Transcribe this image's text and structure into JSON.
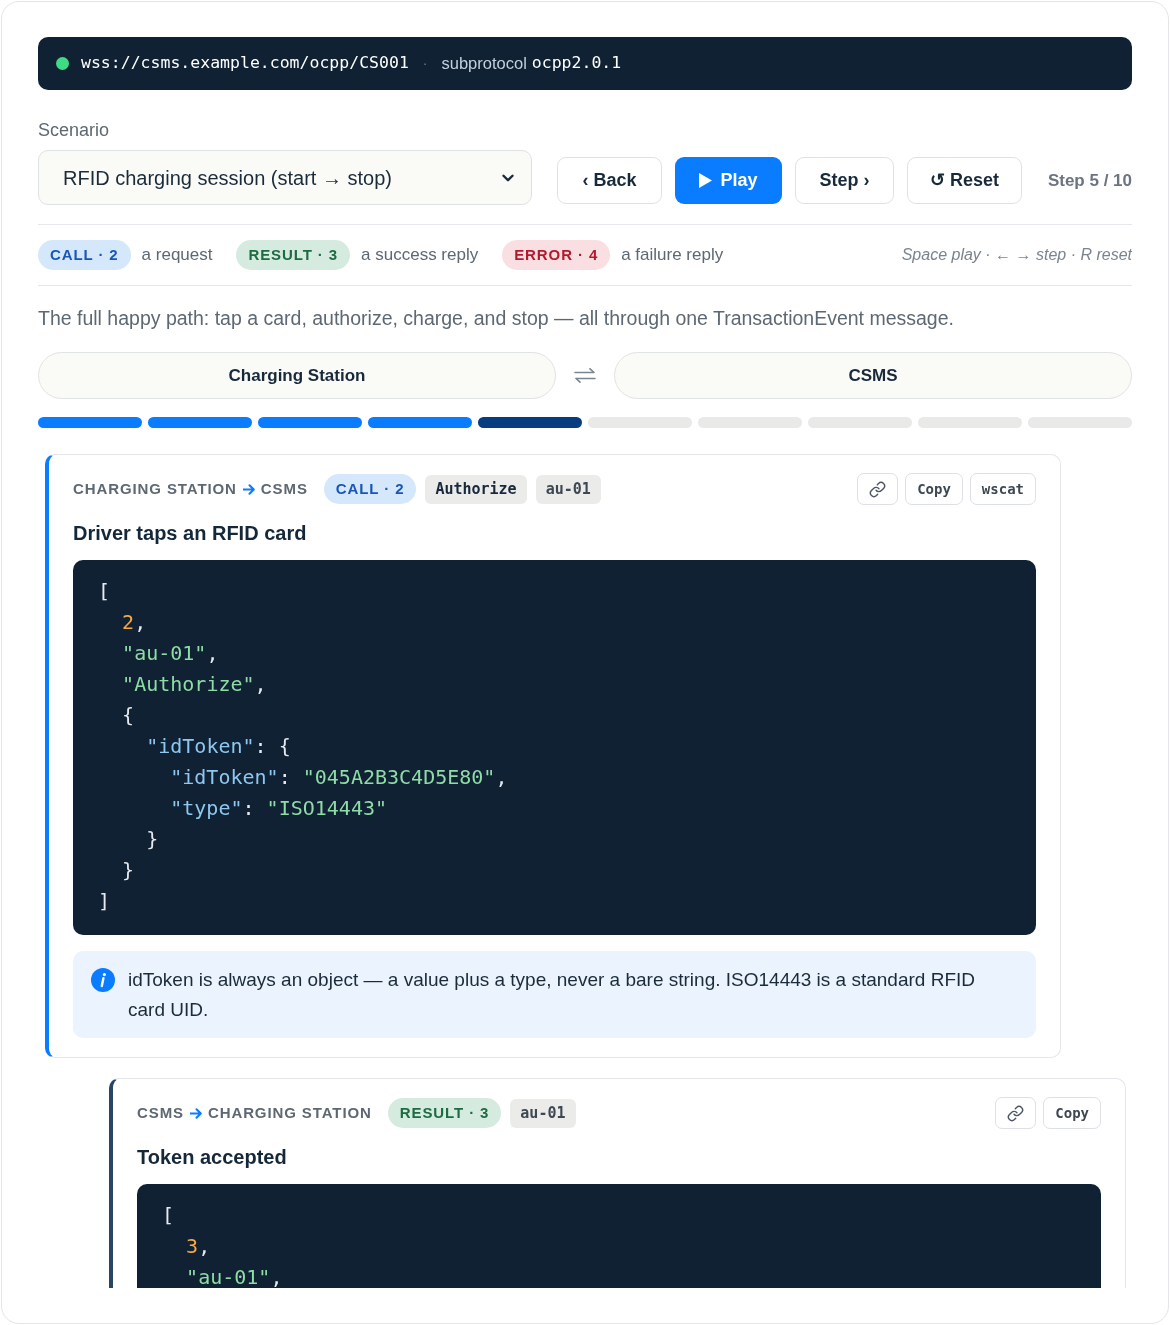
{
  "connection": {
    "connected": true,
    "url": "wss://csms.example.com/ocpp/CS001",
    "separator": "·",
    "label": "subprotocol",
    "value": "ocpp2.0.1"
  },
  "scenario": {
    "label": "Scenario",
    "value": "RFID charging session (start → stop)"
  },
  "controls": [
    {
      "kind": "back",
      "label": "‹ Back"
    },
    {
      "kind": "play",
      "label": "Play"
    },
    {
      "kind": "step",
      "label": "Step ›"
    },
    {
      "kind": "reset",
      "label": "↺ Reset"
    }
  ],
  "step_counter": "Step 5 / 10",
  "legend": [
    {
      "kind": "call",
      "tag": "CALL · 2",
      "text": "a request"
    },
    {
      "kind": "result",
      "tag": "RESULT · 3",
      "text": "a success reply"
    },
    {
      "kind": "error",
      "tag": "ERROR · 4",
      "text": "a failure reply"
    }
  ],
  "shortcuts": "Space play · ← → step · R reset",
  "description": "The full happy path: tap a card, authorize, charge, and stop — all through one TransactionEvent message.",
  "participants": [
    "Charging Station",
    "CSMS"
  ],
  "progress": [
    {
      "filled": true,
      "selected": false
    },
    {
      "filled": true,
      "selected": false
    },
    {
      "filled": true,
      "selected": false
    },
    {
      "filled": true,
      "selected": false
    },
    {
      "filled": true,
      "selected": true
    },
    {
      "filled": false,
      "selected": false
    },
    {
      "filled": false,
      "selected": false
    },
    {
      "filled": false,
      "selected": false
    },
    {
      "filled": false,
      "selected": false
    },
    {
      "filled": false,
      "selected": false
    }
  ],
  "messages": [
    {
      "kind": "call",
      "selected": true,
      "from": "CHARGING STATION",
      "to": "CSMS",
      "tag": "CALL · 2",
      "chips": [
        {
          "kind": "action",
          "text": "Authorize"
        },
        {
          "kind": "id",
          "text": "au-01"
        }
      ],
      "actions": [
        {
          "kind": "link"
        },
        {
          "kind": "copy",
          "label": "Copy"
        },
        {
          "kind": "wscat",
          "label": "wscat"
        }
      ],
      "title": "Driver taps an RFID card",
      "code": [
        [
          {
            "kind": "punct",
            "text": "["
          }
        ],
        [
          {
            "kind": "number",
            "text": "  2"
          },
          {
            "kind": "punct",
            "text": ","
          }
        ],
        [
          {
            "kind": "string",
            "text": "  \"au-01\""
          },
          {
            "kind": "punct",
            "text": ","
          }
        ],
        [
          {
            "kind": "string",
            "text": "  \"Authorize\""
          },
          {
            "kind": "punct",
            "text": ","
          }
        ],
        [
          {
            "kind": "punct",
            "text": "  {"
          }
        ],
        [
          {
            "kind": "key",
            "text": "    \"idToken\""
          },
          {
            "kind": "punct",
            "text": ": {"
          }
        ],
        [
          {
            "kind": "key",
            "text": "      \"idToken\""
          },
          {
            "kind": "punct",
            "text": ": "
          },
          {
            "kind": "string",
            "text": "\"045A2B3C4D5E80\""
          },
          {
            "kind": "punct",
            "text": ","
          }
        ],
        [
          {
            "kind": "key",
            "text": "      \"type\""
          },
          {
            "kind": "punct",
            "text": ": "
          },
          {
            "kind": "string",
            "text": "\"ISO14443\""
          }
        ],
        [
          {
            "kind": "punct",
            "text": "    }"
          }
        ],
        [
          {
            "kind": "punct",
            "text": "  }"
          }
        ],
        [
          {
            "kind": "punct",
            "text": "]"
          }
        ]
      ],
      "note": "idToken is always an object — a value plus a type, never a bare string. ISO14443 is a standard RFID card UID."
    },
    {
      "kind": "result",
      "selected": false,
      "from": "CSMS",
      "to": "CHARGING STATION",
      "tag": "RESULT · 3",
      "chips": [
        {
          "kind": "id",
          "text": "au-01"
        }
      ],
      "actions": [
        {
          "kind": "link"
        },
        {
          "kind": "copy",
          "label": "Copy"
        }
      ],
      "title": "Token accepted",
      "code": [
        [
          {
            "kind": "punct",
            "text": "["
          }
        ],
        [
          {
            "kind": "number",
            "text": "  3"
          },
          {
            "kind": "punct",
            "text": ","
          }
        ],
        [
          {
            "kind": "string",
            "text": "  \"au-01\""
          },
          {
            "kind": "punct",
            "text": ","
          }
        ]
      ]
    }
  ]
}
